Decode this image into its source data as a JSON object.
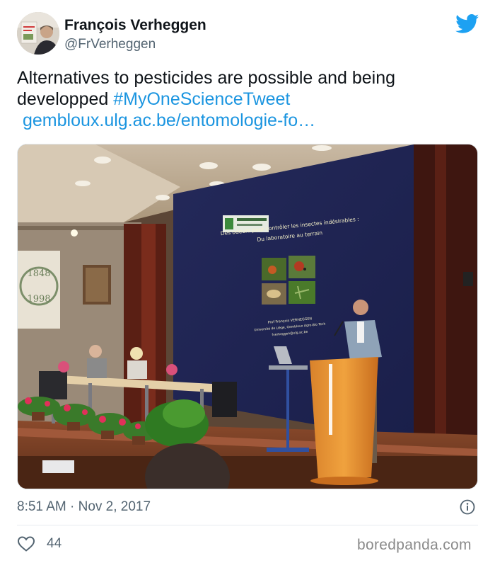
{
  "author": {
    "name": "François Verheggen",
    "handle": "@FrVerheggen"
  },
  "tweet": {
    "text": "Alternatives to pesticides are possible and being developped",
    "hashtag": "#MyOneScienceTweet",
    "link": "gembloux.ulg.ac.be/entomologie-fo…"
  },
  "slide": {
    "title_line1": "Des odeurs pour contrôler les insectes indésirables :",
    "title_line2": "Du laboratoire au terrain",
    "speaker_name": "Prof François VERHEGGEN",
    "speaker_affiliation": "Université de Liège, Gembloux Agro-Bio Tech",
    "speaker_email": "fverheggen@ulg.ac.be"
  },
  "banner": {
    "years_top": "1848",
    "years_bottom": "1998"
  },
  "footer": {
    "timestamp": "8:51 AM · Nov 2, 2017",
    "likes": "44",
    "watermark": "boredpanda.com"
  },
  "icons": {
    "brand": "twitter-bird-icon",
    "info": "info-icon",
    "like": "heart-icon"
  },
  "colors": {
    "link": "#1b95e0",
    "brand": "#1da1f2",
    "text": "#0f1419",
    "secondary": "#536471"
  }
}
